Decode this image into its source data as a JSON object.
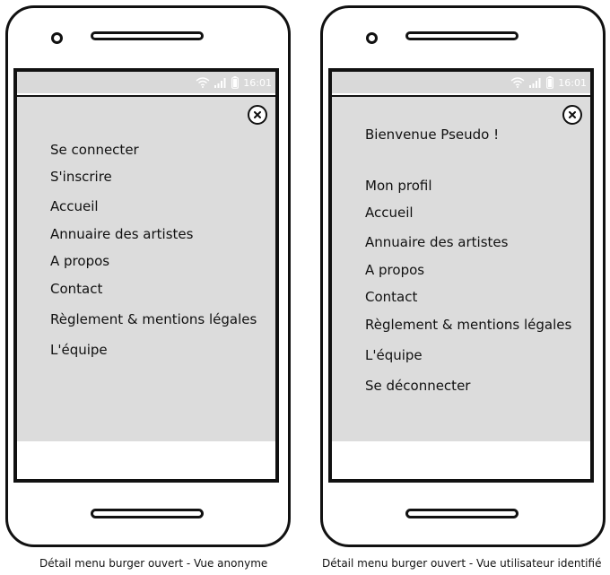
{
  "status_bar": {
    "time": "16:01",
    "icons": [
      "wifi-icon",
      "signal-icon",
      "battery-icon"
    ],
    "background": "#d9d9d9",
    "foreground": "#ffffff"
  },
  "anonymous_view": {
    "caption": "Détail menu burger ouvert - Vue anonyme",
    "close_icon": "close-circle-icon",
    "menu_items": [
      "Se connecter",
      "S'inscrire",
      "Accueil",
      "Annuaire des artistes",
      "A propos",
      "Contact",
      "Règlement & mentions légales",
      "L'équipe"
    ]
  },
  "user_view": {
    "caption": "Détail menu burger ouvert - Vue utilisateur identifié",
    "close_icon": "close-circle-icon",
    "welcome": "Bienvenue Pseudo !",
    "menu_items": [
      "Mon profil",
      "Accueil",
      "Annuaire des artistes",
      "A propos",
      "Contact",
      "Règlement & mentions légales",
      "L'équipe",
      "Se déconnecter"
    ]
  },
  "colors": {
    "outline": "#111111",
    "menu_background": "#dcdcdc"
  }
}
